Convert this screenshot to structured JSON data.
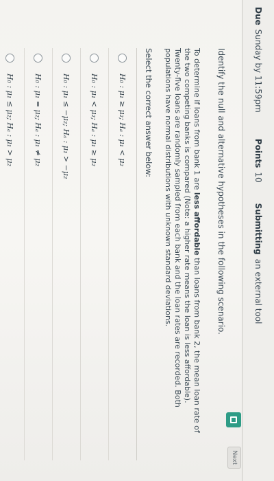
{
  "header": {
    "due_label": "Due",
    "due_value": "Sunday by 11:59pm",
    "points_label": "Points",
    "points_value": "10",
    "submitting_label": "Submitting",
    "submitting_value": "an external tool"
  },
  "question": {
    "intro": "Identify the null and alternative hypotheses in the following scenario.",
    "scenario_part1": "To determine if loans from bank 1 are ",
    "scenario_bold": "less affordable",
    "scenario_part2": " than loans from bank 2, the mean loan rate of the two competing banks is compared (Note: a higher rate means the loan is less affordable). Twenty-five loans are randomly sampled from each bank and the loan rates are recorded. Both populations have normal distributions with unknown standard deviations.",
    "prompt": "Select the correct answer below:",
    "options": [
      "H₀ : μ₁ ≥ μ₂; Hₐ : μ₁ < μ₂",
      "H₀ : μ₁ < μ₂; Hₐ : μ₁ ≥ μ₂",
      "H₀ : μ₁ ≤ −μ₂; Hₐ : μ₁ > −μ₂",
      "H₀ : μ₁ = μ₂; Hₐ : μ₁ ≠ μ₂",
      "H₀ : μ₁ ≤ μ₂; Hₐ : μ₁ > μ₂"
    ]
  },
  "controls": {
    "next_label": "Next",
    "accent_color": "#2e9c86"
  }
}
